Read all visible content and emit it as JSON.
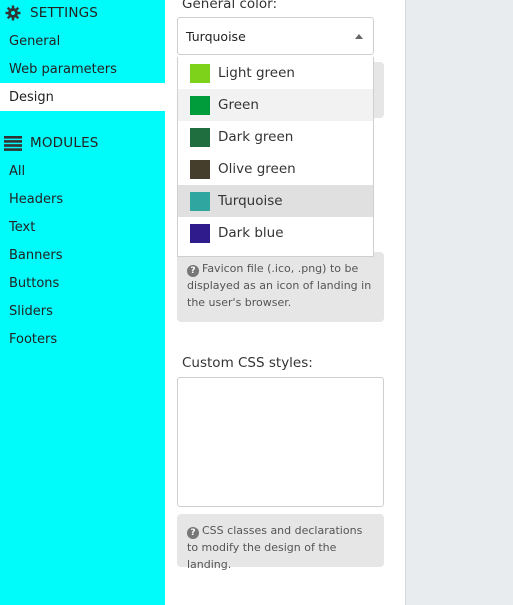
{
  "sidebar": {
    "settings_title": "SETTINGS",
    "settings_icon": "gear-icon",
    "settings_items": [
      {
        "label": "General"
      },
      {
        "label": "Web parameters"
      },
      {
        "label": "Design",
        "active": true
      }
    ],
    "modules_title": "MODULES",
    "modules_icon": "list-icon",
    "module_items": [
      {
        "label": "All"
      },
      {
        "label": "Headers"
      },
      {
        "label": "Text"
      },
      {
        "label": "Banners"
      },
      {
        "label": "Buttons"
      },
      {
        "label": "Sliders"
      },
      {
        "label": "Footers"
      }
    ]
  },
  "main": {
    "general_color_label": "General color:",
    "general_color_value": "Turquoise",
    "color_options": [
      {
        "label": "Light green",
        "color": "#7ed31a"
      },
      {
        "label": "Green",
        "color": "#009b3a"
      },
      {
        "label": "Dark green",
        "color": "#1f6e3f"
      },
      {
        "label": "Olive green",
        "color": "#453e2c"
      },
      {
        "label": "Turquoise",
        "color": "#2fa6a0",
        "selected": true
      },
      {
        "label": "Dark blue",
        "color": "#2f1b8c"
      }
    ],
    "favicon_help": "Favicon file (.ico, .png) to be displayed as an icon of landing in the user's browser.",
    "custom_css_label": "Custom CSS styles:",
    "custom_css_value": "",
    "css_help": "CSS classes and declarations to modify the design of the landing."
  },
  "colors": {
    "sidebar_bg": "#00fbfb",
    "right_bg": "#e8ecee",
    "help_bg": "#e6e6e6"
  }
}
